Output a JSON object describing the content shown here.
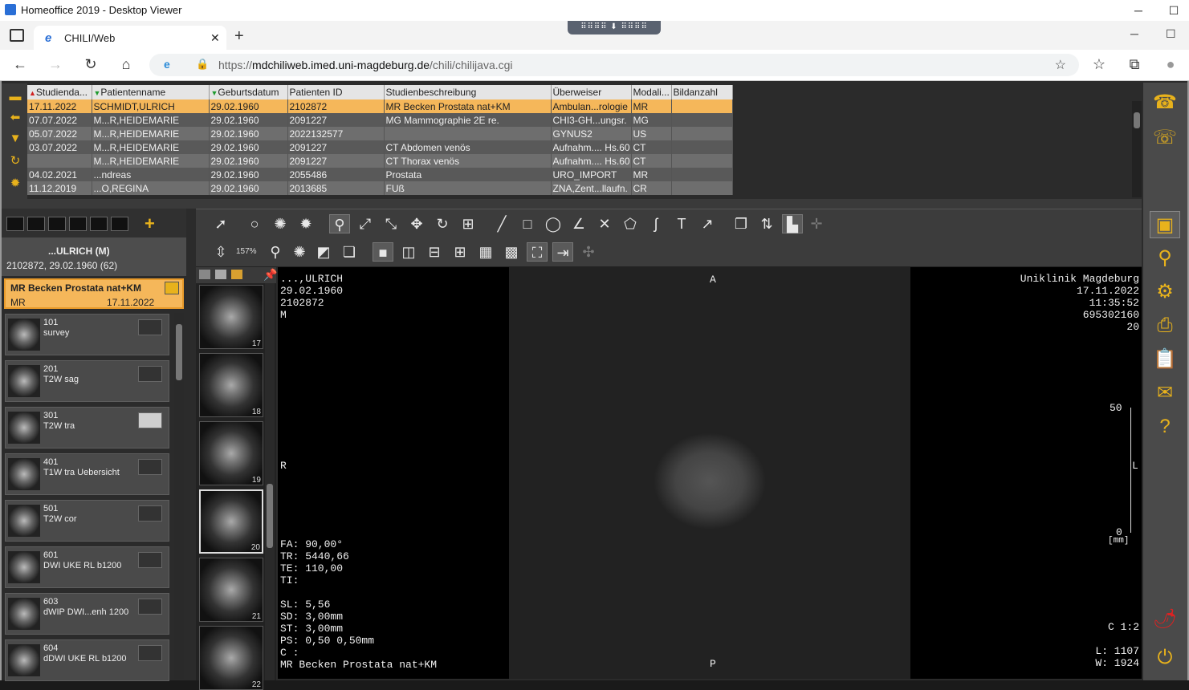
{
  "window": {
    "title": "Homeoffice 2019 - Desktop Viewer",
    "minimize": "─",
    "maximize": "☐",
    "close": "✕",
    "drag_handle": "⠿⠿⠿⠿ ⬇ ⠿⠿⠿⠿"
  },
  "browser": {
    "tab_title": "CHILI/Web",
    "tab_close": "✕",
    "new_tab": "+",
    "url": "https://mdchiliweb.imed.uni-magdeburg.de/chili/chilijava.cgi",
    "url_host": "mdchiliweb.imed.uni-magdeburg.de",
    "url_path": "/chili/chilijava.cgi",
    "url_scheme": "https://",
    "back": "←",
    "forward": "→",
    "reload": "↻",
    "home": "⌂",
    "favorites": "☆",
    "collections": "⧉",
    "profile": "●",
    "add_fav": "☆"
  },
  "study_list": {
    "columns": [
      "Studienda...",
      "Patientenname",
      "Geburtsdatum",
      "Patienten ID",
      "Studienbeschreibung",
      "Überweiser",
      "Modali...",
      "Bildanzahl"
    ],
    "rows": [
      [
        "17.11.2022",
        "SCHMIDT,ULRICH",
        "29.02.1960",
        "2102872",
        "MR Becken Prostata nat+KM",
        "Ambulan...rologie",
        "MR",
        ""
      ],
      [
        "07.07.2022",
        "M...R,HEIDEMARIE",
        "29.02.1960",
        "2091227",
        "MG Mammographie 2E re.",
        "CHI3-GH...ungsr.",
        "MG",
        ""
      ],
      [
        "05.07.2022",
        "M...R,HEIDEMARIE",
        "29.02.1960",
        "2022132577",
        "",
        "GYNUS2",
        "US",
        ""
      ],
      [
        "03.07.2022",
        "M...R,HEIDEMARIE",
        "29.02.1960",
        "2091227",
        "CT Abdomen venös",
        "Aufnahm.... Hs.60",
        "CT",
        ""
      ],
      [
        "",
        "M...R,HEIDEMARIE",
        "29.02.1960",
        "2091227",
        "CT Thorax venös",
        "Aufnahm.... Hs.60",
        "CT",
        ""
      ],
      [
        "04.02.2021",
        "...ndreas",
        "29.02.1960",
        "2055486",
        "Prostata",
        "URO_IMPORT",
        "MR",
        ""
      ],
      [
        "11.12.2019",
        "...O,REGINA",
        "29.02.1960",
        "2013685",
        "FUß",
        "ZNA,Zent...llaufn.",
        "CR",
        ""
      ]
    ]
  },
  "patient": {
    "name": "...ULRICH (M)",
    "id_line": "2102872, 29.02.1960 (62)"
  },
  "study_header": {
    "desc": "MR Becken Prostata nat+KM",
    "modality": "MR",
    "date": "17.11.2022"
  },
  "series": [
    {
      "num": "101",
      "name": "survey"
    },
    {
      "num": "201",
      "name": "T2W sag"
    },
    {
      "num": "301",
      "name": "T2W tra"
    },
    {
      "num": "401",
      "name": "T1W tra Uebersicht"
    },
    {
      "num": "501",
      "name": "T2W cor"
    },
    {
      "num": "601",
      "name": "DWI UKE RL b1200"
    },
    {
      "num": "603",
      "name": "dWIP DWI...enh 1200"
    },
    {
      "num": "604",
      "name": "dDWI UKE RL b1200"
    }
  ],
  "thumbnails": [
    "17",
    "18",
    "19",
    "20",
    "21",
    "22"
  ],
  "toolbar": {
    "zoom": "157%",
    "add": "+"
  },
  "overlay": {
    "tl": "...,ULRICH\n29.02.1960\n2102872\nM",
    "tr": "Uniklinik Magdeburg\n17.11.2022\n11:35:52\n695302160\n20",
    "params": "FA: 90,00°\nTR: 5440,66\nTE: 110,00\nTI:\n\nSL: 5,56\nSD: 3,00mm\nST: 3,00mm\nPS: 0,50 0,50mm\nC :\nMR Becken Prostata nat+KM",
    "orient_top": "A",
    "orient_bottom": "P",
    "orient_left": "R",
    "orient_right": "L",
    "scale_top": "50",
    "scale_bottom": "0",
    "scale_unit": "[mm]",
    "compress": "C 1:2",
    "wl": "L: 1107\nW: 1924"
  }
}
